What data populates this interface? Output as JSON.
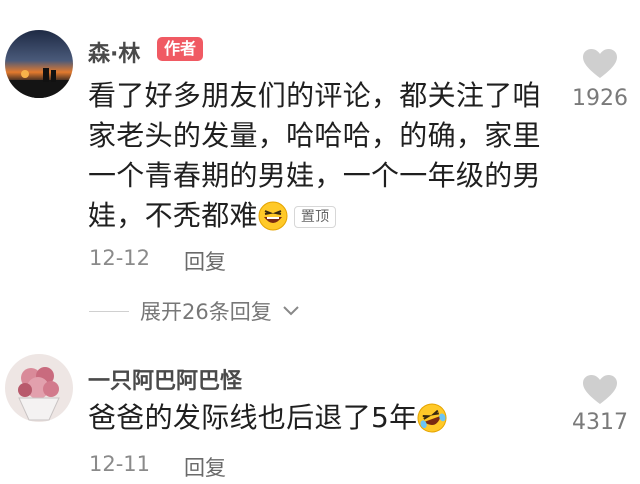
{
  "comments": [
    {
      "user": "森·林",
      "author_badge": "作者",
      "text_lines": [
        "看了好多朋友们的评论，都关注了咱",
        "家老头的发量，哈哈哈，的确，家里",
        "一个青春期的男娃，一个一年级的男",
        "娃，不秃都难"
      ],
      "pin_label": "置顶",
      "emoji": "laughing-face-emoji",
      "date": "12-12",
      "reply_label": "回复",
      "likes": "1926",
      "expand_label": "展开26条回复"
    },
    {
      "user": "一只阿巴阿巴怪",
      "text": "爸爸的发际线也后退了5年",
      "emoji": "rolling-on-floor-laughing-emoji",
      "date": "12-11",
      "reply_label": "回复",
      "likes": "4317"
    }
  ],
  "icons": {
    "like": "heart-icon",
    "expand": "chevron-down-icon"
  },
  "colors": {
    "author_badge": "#f05a63",
    "like_icon": "#cfcfcf"
  }
}
